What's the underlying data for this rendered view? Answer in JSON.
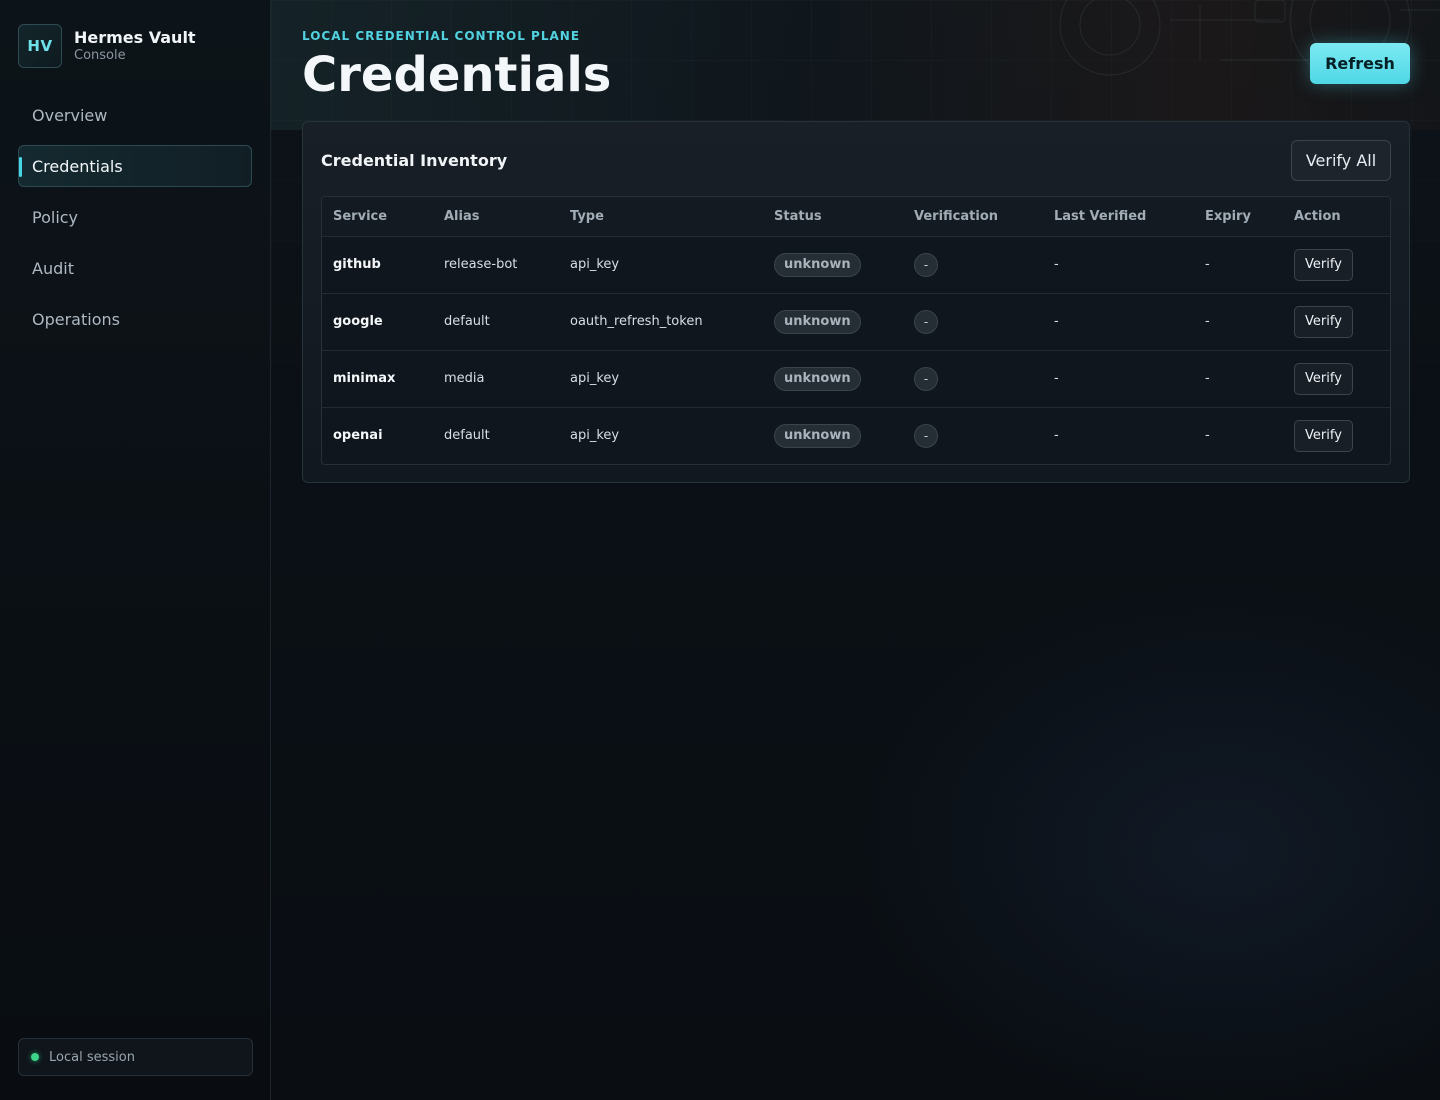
{
  "brand": {
    "badge": "HV",
    "title": "Hermes Vault",
    "subtitle": "Console"
  },
  "nav": [
    {
      "label": "Overview",
      "active": false
    },
    {
      "label": "Credentials",
      "active": true
    },
    {
      "label": "Policy",
      "active": false
    },
    {
      "label": "Audit",
      "active": false
    },
    {
      "label": "Operations",
      "active": false
    }
  ],
  "session": {
    "label": "Local session",
    "status_color": "#3bd48a"
  },
  "header": {
    "eyebrow": "LOCAL CREDENTIAL CONTROL PLANE",
    "title": "Credentials",
    "refresh_label": "Refresh"
  },
  "panel": {
    "title": "Credential Inventory",
    "verify_all_label": "Verify All",
    "columns": [
      "Service",
      "Alias",
      "Type",
      "Status",
      "Verification",
      "Last Verified",
      "Expiry",
      "Action"
    ],
    "rows": [
      {
        "service": "github",
        "alias": "release-bot",
        "type": "api_key",
        "status": "unknown",
        "verification": "-",
        "last_verified": "-",
        "expiry": "-",
        "action": "Verify"
      },
      {
        "service": "google",
        "alias": "default",
        "type": "oauth_refresh_token",
        "status": "unknown",
        "verification": "-",
        "last_verified": "-",
        "expiry": "-",
        "action": "Verify"
      },
      {
        "service": "minimax",
        "alias": "media",
        "type": "api_key",
        "status": "unknown",
        "verification": "-",
        "last_verified": "-",
        "expiry": "-",
        "action": "Verify"
      },
      {
        "service": "openai",
        "alias": "default",
        "type": "api_key",
        "status": "unknown",
        "verification": "-",
        "last_verified": "-",
        "expiry": "-",
        "action": "Verify"
      }
    ]
  },
  "colors": {
    "accent": "#4fd7e6",
    "background": "#0a0e13"
  }
}
